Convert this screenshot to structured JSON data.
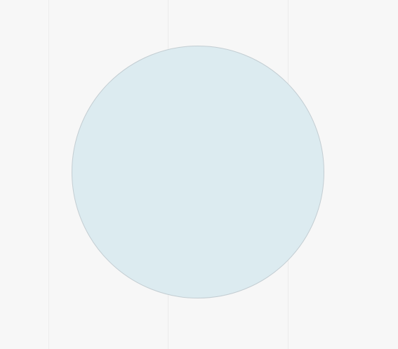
{
  "colors": {
    "background": "#f7f7f7",
    "guide_line": "#ececec",
    "shape_fill": "#dcebf0",
    "shape_stroke": "#c3cdd2"
  },
  "shape": {
    "kind": "circle"
  }
}
